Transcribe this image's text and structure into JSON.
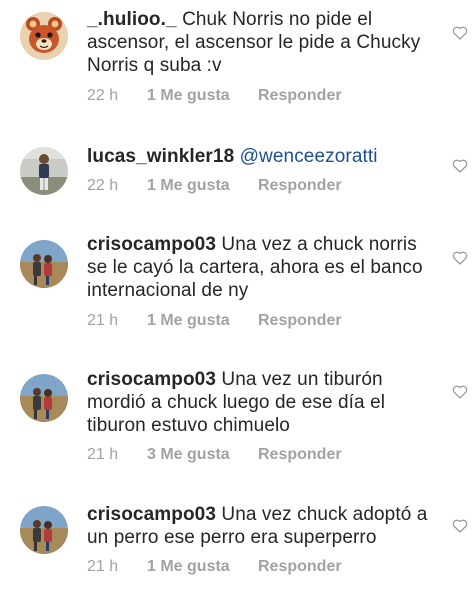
{
  "comments": [
    {
      "username": "_.hulioo._",
      "text": " Chuk Norris no pide el ascensor,  el ascensor le pide a Chucky Norris q suba :v",
      "mention": "",
      "time": "22 h",
      "likes": "1 Me gusta",
      "reply": "Responder",
      "avatar_icon": "bear-avatar-icon"
    },
    {
      "username": "lucas_winkler18",
      "text": " ",
      "mention": "@wenceezoratti",
      "time": "22 h",
      "likes": "1 Me gusta",
      "reply": "Responder",
      "avatar_icon": "person-photo-avatar-icon"
    },
    {
      "username": "crisocampo03",
      "text": " Una vez a chuck norris se le cayó la cartera, ahora es el banco internacional de ny",
      "mention": "",
      "time": "21 h",
      "likes": "1 Me gusta",
      "reply": "Responder",
      "avatar_icon": "group-photo-avatar-icon"
    },
    {
      "username": "crisocampo03",
      "text": " Una vez un tiburón mordió a chuck luego de ese día el tiburon estuvo chimuelo",
      "mention": "",
      "time": "21 h",
      "likes": "3 Me gusta",
      "reply": "Responder",
      "avatar_icon": "group-photo-avatar-icon"
    },
    {
      "username": "crisocampo03",
      "text": " Una vez chuck adoptó a un perro ese perro era superperro",
      "mention": "",
      "time": "21 h",
      "likes": "1 Me gusta",
      "reply": "Responder",
      "avatar_icon": "group-photo-avatar-icon"
    }
  ],
  "colors": {
    "text": "#262626",
    "meta": "#a2a2a2",
    "mention": "#1d4f91",
    "heart": "#9a9a9a"
  }
}
